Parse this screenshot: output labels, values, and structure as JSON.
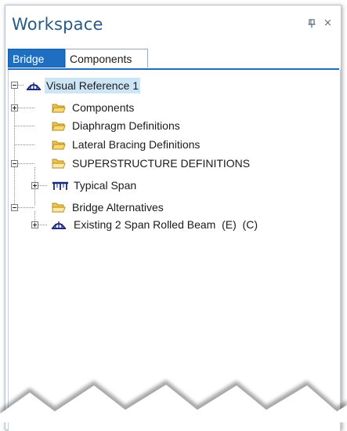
{
  "panel": {
    "title": "Workspace",
    "pin_icon": "pin-icon",
    "close_icon": "close-icon",
    "close_glyph": "×"
  },
  "tabs": [
    {
      "label": "Bridge",
      "active": true
    },
    {
      "label": "Components",
      "active": false
    }
  ],
  "tree": {
    "root": {
      "label": "Visual Reference 1",
      "icon": "bridge-arch-icon",
      "selected": true
    },
    "items": [
      {
        "label": "Components",
        "icon": "folder-closed-icon",
        "expander": "plus"
      },
      {
        "label": "Diaphragm Definitions",
        "icon": "folder-closed-icon",
        "expander": "none"
      },
      {
        "label": "Lateral Bracing Definitions",
        "icon": "folder-closed-icon",
        "expander": "none"
      },
      {
        "label": "SUPERSTRUCTURE DEFINITIONS",
        "icon": "folder-open-icon",
        "expander": "minus"
      },
      {
        "label": "Typical Span",
        "icon": "girder-span-icon",
        "expander": "plus"
      },
      {
        "label": "Bridge Alternatives",
        "icon": "folder-open-icon",
        "expander": "minus"
      },
      {
        "label": "Existing 2 Span Rolled Beam  (E)  (C)",
        "icon": "bridge-arch-icon",
        "expander": "plus"
      }
    ]
  },
  "colors": {
    "title": "#2a5b86",
    "tab_active": "#1e6fc1",
    "selection": "#cde6f7",
    "folder": "#f2c44b",
    "girder": "#1b2a7a"
  }
}
